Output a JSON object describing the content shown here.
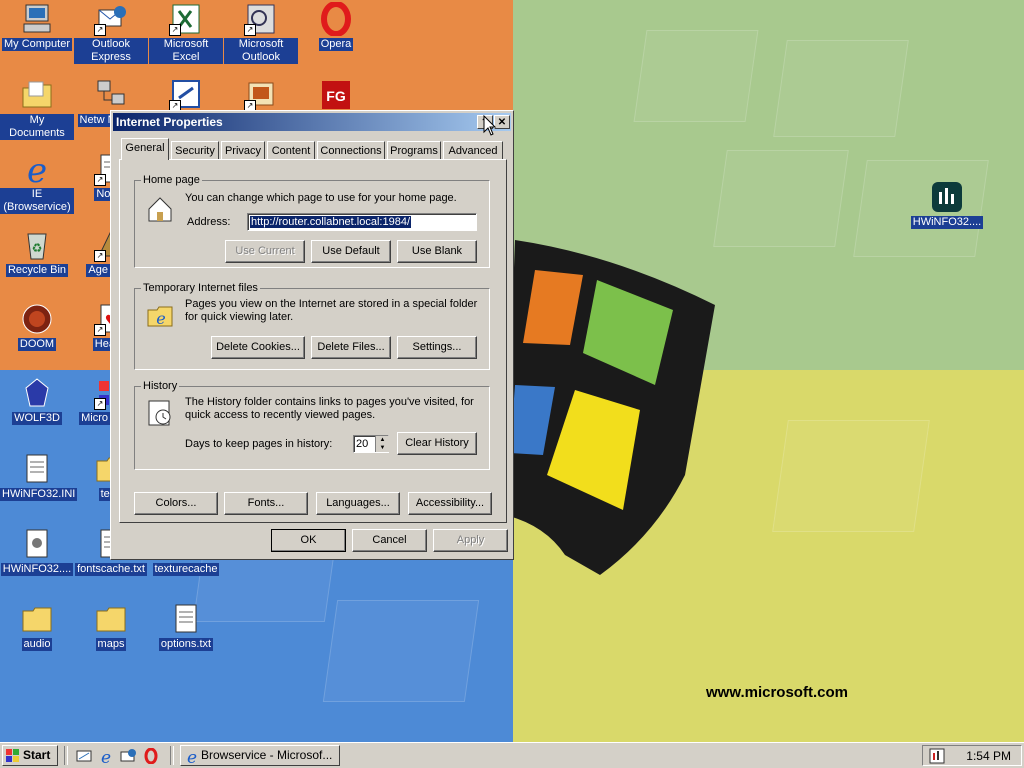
{
  "desktop": {
    "website": "www.microsoft.com",
    "icons": [
      {
        "label": "My Computer",
        "icon": "my-computer-icon"
      },
      {
        "label": "Outlook Express",
        "icon": "outlook-express-icon"
      },
      {
        "label": "Microsoft Excel",
        "icon": "excel-icon"
      },
      {
        "label": "Microsoft Outlook",
        "icon": "outlook-icon"
      },
      {
        "label": "Opera",
        "icon": "opera-icon"
      },
      {
        "label": "My Documents",
        "icon": "folder-documents-icon"
      },
      {
        "label": "Netw Neighb",
        "icon": "network-icon"
      },
      {
        "label": "",
        "icon": "program-shortcut-icon"
      },
      {
        "label": "",
        "icon": "program-shortcut-icon"
      },
      {
        "label": "",
        "icon": "fg-app-icon"
      },
      {
        "label": "IE (Browservice)",
        "icon": "internet-explorer-icon"
      },
      {
        "label": "Notep",
        "icon": "notepad-icon"
      },
      {
        "label": "Recycle Bin",
        "icon": "recycle-bin-icon"
      },
      {
        "label": "Age Emp",
        "icon": "age-of-empires-icon"
      },
      {
        "label": "DOOM",
        "icon": "doom-icon"
      },
      {
        "label": "Hearts",
        "icon": "hearts-icon"
      },
      {
        "label": "WOLF3D",
        "icon": "wolf3d-icon"
      },
      {
        "label": "Micro Visual",
        "icon": "visual-studio-icon"
      },
      {
        "label": "HWiNFO32.INI",
        "icon": "ini-file-icon"
      },
      {
        "label": "texp",
        "icon": "folder-icon"
      },
      {
        "label": "HWiNFO32....",
        "icon": "hwinfo-settings-icon"
      },
      {
        "label": "fontscache.txt",
        "icon": "text-file-icon"
      },
      {
        "label": "texturecache",
        "icon": "text-file-icon"
      },
      {
        "label": "audio",
        "icon": "folder-icon"
      },
      {
        "label": "maps",
        "icon": "folder-icon"
      },
      {
        "label": "options.txt",
        "icon": "text-file-icon"
      },
      {
        "label": "HWiNFO32....",
        "icon": "hwinfo-icon"
      }
    ]
  },
  "dialog": {
    "title": "Internet Properties",
    "help": "?",
    "close": "✕",
    "tabs": [
      "General",
      "Security",
      "Privacy",
      "Content",
      "Connections",
      "Programs",
      "Advanced"
    ],
    "homepage": {
      "legend": "Home page",
      "desc": "You can change which page to use for your home page.",
      "address_label": "Address:",
      "address_value": "http://router.collabnet.local:1984/",
      "use_current": "Use Current",
      "use_default": "Use Default",
      "use_blank": "Use Blank"
    },
    "temp": {
      "legend": "Temporary Internet files",
      "desc1": "Pages you view on the Internet are stored in a special folder",
      "desc2": "for quick viewing later.",
      "delete_cookies": "Delete Cookies...",
      "delete_files": "Delete Files...",
      "settings": "Settings..."
    },
    "history": {
      "legend": "History",
      "desc1": "The History folder contains links to pages you've visited, for",
      "desc2": "quick access to recently viewed pages.",
      "days_label": "Days to keep pages in history:",
      "days_value": "20",
      "clear": "Clear History"
    },
    "bottom_buttons": [
      "Colors...",
      "Fonts...",
      "Languages...",
      "Accessibility..."
    ],
    "ok": "OK",
    "cancel": "Cancel",
    "apply": "Apply"
  },
  "taskbar": {
    "start": "Start",
    "task": "Browservice - Microsof...",
    "clock": "1:54 PM",
    "quicklaunch": [
      "show-desktop-icon",
      "internet-explorer-icon",
      "outlook-express-icon",
      "opera-icon"
    ]
  }
}
